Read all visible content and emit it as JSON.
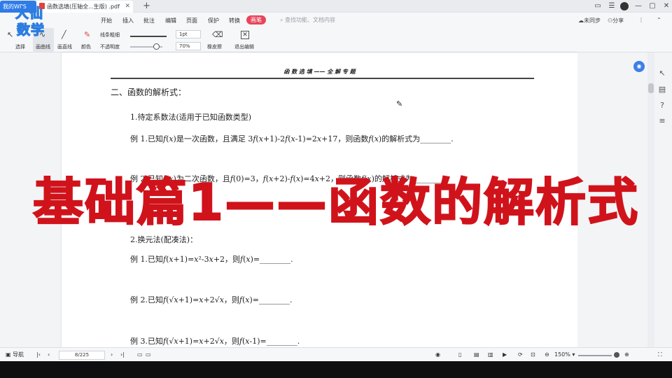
{
  "titlebar": {
    "home_tab": "我的WPS",
    "doc_tab": "函数选填(压轴全...生版) .pdf",
    "add_tab": "+",
    "window_controls": [
      "▭",
      "☰",
      "—",
      "▢",
      "✕"
    ]
  },
  "logo": {
    "line1": "大仙",
    "line2": "数学"
  },
  "menu": {
    "items": [
      "开始",
      "插入",
      "批注",
      "编辑",
      "页面",
      "保护",
      "转换"
    ],
    "active": "画笔",
    "search_placeholder": "查找功能、文档内容",
    "right_tools": [
      "未同步",
      "分享"
    ]
  },
  "ribbon": {
    "select": "选择",
    "draw": "画曲线",
    "line": "画直线",
    "color": "颜色",
    "thickness_label": "线条粗细",
    "thickness_value": "1pt",
    "opacity_label": "不透明度",
    "opacity_value": "70%",
    "eraser": "橡皮擦",
    "exit": "退出编辑",
    "opacity_fraction": 0.7
  },
  "document": {
    "header": "函 数 选 填 —— 全 解 专 题",
    "section_title": "二、函数的解析式：",
    "sub1": "1.待定系数法(适用于已知函数类型)",
    "ex1": "例 1.已知𝑓(𝑥)是一次函数，且满足 3𝑓(𝑥+1)-2𝑓(𝑥-1)=2𝑥+17，则函数𝑓(𝑥)的解析式为________.",
    "ex2": "例 2.已知𝑓(𝑥)为二次函数，且𝑓(0)=3，𝑓(𝑥+2)-𝑓(𝑥)=4𝑥+2，则函数𝑓(𝑥)的解析式为________.",
    "sub2": "2.换元法(配凑法)：",
    "ex3": "例 1.已知𝑓(𝑥+1)=𝑥²-3𝑥+2，则𝑓(𝑥)=________.",
    "ex4": "例 2.已知𝑓(√𝑥+1)=𝑥+2√𝑥，则𝑓(𝑥)=________.",
    "ex5": "例 3.已知𝑓(√𝑥+1)=𝑥+2√𝑥，则𝑓(𝑥-1)=________."
  },
  "overlay": {
    "title": "基础篇1——函数的解析式"
  },
  "statusbar": {
    "nav": "导航",
    "page": "8/225",
    "zoom": "150%"
  },
  "colors": {
    "accent": "#2f7be8",
    "overlay_red": "#d0131b",
    "pen_tab": "#e8455a"
  }
}
